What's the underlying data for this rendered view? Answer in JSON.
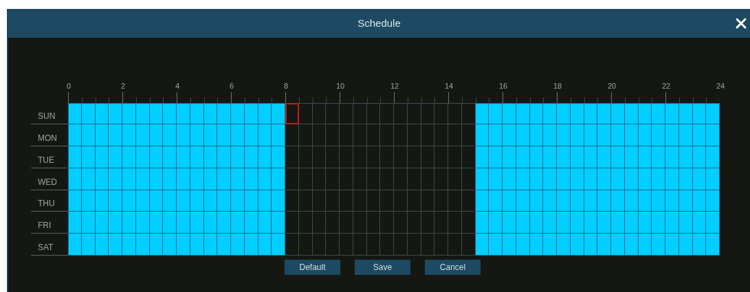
{
  "window": {
    "title": "Schedule"
  },
  "hours": [
    "0",
    "2",
    "4",
    "6",
    "8",
    "10",
    "12",
    "14",
    "16",
    "18",
    "20",
    "22",
    "24"
  ],
  "days": [
    {
      "label": "SUN",
      "scheduled": [
        true,
        true,
        true,
        true,
        true,
        true,
        true,
        true,
        true,
        true,
        true,
        true,
        true,
        true,
        true,
        true,
        false,
        false,
        false,
        false,
        false,
        false,
        false,
        false,
        false,
        false,
        false,
        false,
        false,
        false,
        true,
        true,
        true,
        true,
        true,
        true,
        true,
        true,
        true,
        true,
        true,
        true,
        true,
        true,
        true,
        true,
        true,
        true
      ],
      "focused": [
        false,
        false,
        false,
        false,
        false,
        false,
        false,
        false,
        false,
        false,
        false,
        false,
        false,
        false,
        false,
        false,
        true,
        false,
        false,
        false,
        false,
        false,
        false,
        false,
        false,
        false,
        false,
        false,
        false,
        false,
        false,
        false,
        false,
        false,
        false,
        false,
        false,
        false,
        false,
        false,
        false,
        false,
        false,
        false,
        false,
        false,
        false,
        false
      ]
    },
    {
      "label": "MON",
      "scheduled": [
        true,
        true,
        true,
        true,
        true,
        true,
        true,
        true,
        true,
        true,
        true,
        true,
        true,
        true,
        true,
        true,
        false,
        false,
        false,
        false,
        false,
        false,
        false,
        false,
        false,
        false,
        false,
        false,
        false,
        false,
        true,
        true,
        true,
        true,
        true,
        true,
        true,
        true,
        true,
        true,
        true,
        true,
        true,
        true,
        true,
        true,
        true,
        true
      ],
      "focused": [
        false,
        false,
        false,
        false,
        false,
        false,
        false,
        false,
        false,
        false,
        false,
        false,
        false,
        false,
        false,
        false,
        false,
        false,
        false,
        false,
        false,
        false,
        false,
        false,
        false,
        false,
        false,
        false,
        false,
        false,
        false,
        false,
        false,
        false,
        false,
        false,
        false,
        false,
        false,
        false,
        false,
        false,
        false,
        false,
        false,
        false,
        false,
        false
      ]
    },
    {
      "label": "TUE",
      "scheduled": [
        true,
        true,
        true,
        true,
        true,
        true,
        true,
        true,
        true,
        true,
        true,
        true,
        true,
        true,
        true,
        true,
        false,
        false,
        false,
        false,
        false,
        false,
        false,
        false,
        false,
        false,
        false,
        false,
        false,
        false,
        true,
        true,
        true,
        true,
        true,
        true,
        true,
        true,
        true,
        true,
        true,
        true,
        true,
        true,
        true,
        true,
        true,
        true
      ],
      "focused": [
        false,
        false,
        false,
        false,
        false,
        false,
        false,
        false,
        false,
        false,
        false,
        false,
        false,
        false,
        false,
        false,
        false,
        false,
        false,
        false,
        false,
        false,
        false,
        false,
        false,
        false,
        false,
        false,
        false,
        false,
        false,
        false,
        false,
        false,
        false,
        false,
        false,
        false,
        false,
        false,
        false,
        false,
        false,
        false,
        false,
        false,
        false,
        false
      ]
    },
    {
      "label": "WED",
      "scheduled": [
        true,
        true,
        true,
        true,
        true,
        true,
        true,
        true,
        true,
        true,
        true,
        true,
        true,
        true,
        true,
        true,
        false,
        false,
        false,
        false,
        false,
        false,
        false,
        false,
        false,
        false,
        false,
        false,
        false,
        false,
        true,
        true,
        true,
        true,
        true,
        true,
        true,
        true,
        true,
        true,
        true,
        true,
        true,
        true,
        true,
        true,
        true,
        true
      ],
      "focused": [
        false,
        false,
        false,
        false,
        false,
        false,
        false,
        false,
        false,
        false,
        false,
        false,
        false,
        false,
        false,
        false,
        false,
        false,
        false,
        false,
        false,
        false,
        false,
        false,
        false,
        false,
        false,
        false,
        false,
        false,
        false,
        false,
        false,
        false,
        false,
        false,
        false,
        false,
        false,
        false,
        false,
        false,
        false,
        false,
        false,
        false,
        false,
        false
      ]
    },
    {
      "label": "THU",
      "scheduled": [
        true,
        true,
        true,
        true,
        true,
        true,
        true,
        true,
        true,
        true,
        true,
        true,
        true,
        true,
        true,
        true,
        false,
        false,
        false,
        false,
        false,
        false,
        false,
        false,
        false,
        false,
        false,
        false,
        false,
        false,
        true,
        true,
        true,
        true,
        true,
        true,
        true,
        true,
        true,
        true,
        true,
        true,
        true,
        true,
        true,
        true,
        true,
        true
      ],
      "focused": [
        false,
        false,
        false,
        false,
        false,
        false,
        false,
        false,
        false,
        false,
        false,
        false,
        false,
        false,
        false,
        false,
        false,
        false,
        false,
        false,
        false,
        false,
        false,
        false,
        false,
        false,
        false,
        false,
        false,
        false,
        false,
        false,
        false,
        false,
        false,
        false,
        false,
        false,
        false,
        false,
        false,
        false,
        false,
        false,
        false,
        false,
        false,
        false
      ]
    },
    {
      "label": "FRI",
      "scheduled": [
        true,
        true,
        true,
        true,
        true,
        true,
        true,
        true,
        true,
        true,
        true,
        true,
        true,
        true,
        true,
        true,
        false,
        false,
        false,
        false,
        false,
        false,
        false,
        false,
        false,
        false,
        false,
        false,
        false,
        false,
        true,
        true,
        true,
        true,
        true,
        true,
        true,
        true,
        true,
        true,
        true,
        true,
        true,
        true,
        true,
        true,
        true,
        true
      ],
      "focused": [
        false,
        false,
        false,
        false,
        false,
        false,
        false,
        false,
        false,
        false,
        false,
        false,
        false,
        false,
        false,
        false,
        false,
        false,
        false,
        false,
        false,
        false,
        false,
        false,
        false,
        false,
        false,
        false,
        false,
        false,
        false,
        false,
        false,
        false,
        false,
        false,
        false,
        false,
        false,
        false,
        false,
        false,
        false,
        false,
        false,
        false,
        false,
        false
      ]
    },
    {
      "label": "SAT",
      "scheduled": [
        true,
        true,
        true,
        true,
        true,
        true,
        true,
        true,
        true,
        true,
        true,
        true,
        true,
        true,
        true,
        true,
        false,
        false,
        false,
        false,
        false,
        false,
        false,
        false,
        false,
        false,
        false,
        false,
        false,
        false,
        true,
        true,
        true,
        true,
        true,
        true,
        true,
        true,
        true,
        true,
        true,
        true,
        true,
        true,
        true,
        true,
        true,
        true
      ],
      "focused": [
        false,
        false,
        false,
        false,
        false,
        false,
        false,
        false,
        false,
        false,
        false,
        false,
        false,
        false,
        false,
        false,
        false,
        false,
        false,
        false,
        false,
        false,
        false,
        false,
        false,
        false,
        false,
        false,
        false,
        false,
        false,
        false,
        false,
        false,
        false,
        false,
        false,
        false,
        false,
        false,
        false,
        false,
        false,
        false,
        false,
        false,
        false,
        false
      ]
    }
  ],
  "buttons": [
    "Default",
    "Save",
    "Cancel"
  ]
}
